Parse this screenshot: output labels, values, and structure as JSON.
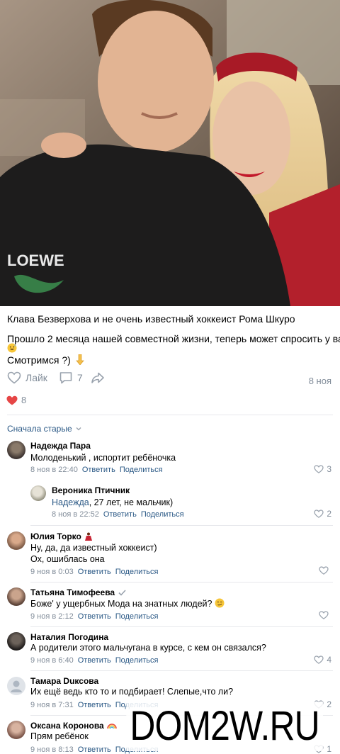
{
  "post": {
    "title": "Клава Безверхова и не очень известный хоккеист Рома Шкуро",
    "line1": "Прошло 2 месяца нашей совместной жизни, теперь может спросить у вас",
    "line2": "Смотримся ?)",
    "like_label": "Лайк",
    "comment_count": "7",
    "date": "8 ноя",
    "reaction_count": "8"
  },
  "comments_header": {
    "sort_label": "Сначала старые"
  },
  "comments": [
    {
      "name": "Надежда Пара",
      "text": "Молоденький , испортит ребёночка",
      "time": "8 ноя в 22:40",
      "reply": "Ответить",
      "share": "Поделиться",
      "likes": "3"
    },
    {
      "name": "Вероника Птичник",
      "reply_to": "Надежда",
      "text": ", 27 лет, не мальчик)",
      "time": "8 ноя в 22:52",
      "reply": "Ответить",
      "share": "Поделиться",
      "likes": "2"
    },
    {
      "name": "Юлия Торко",
      "text": "Ну, да, да известный хоккеист)",
      "text2": "Ох, ошиблась она",
      "time": "9 ноя в 0:03",
      "reply": "Ответить",
      "share": "Поделиться"
    },
    {
      "name": "Татьяна Тимофеева",
      "text": "Боже' у ущербных Мода на знатных людей?",
      "time": "9 ноя в 2:12",
      "reply": "Ответить",
      "share": "Поделиться"
    },
    {
      "name": "Наталия Погодина",
      "text": "А родители этого мальчугана в курсе, с кем он связался?",
      "time": "9 ноя в 6:40",
      "reply": "Ответить",
      "share": "Поделиться",
      "likes": "4"
    },
    {
      "name": "Тамара Duксова",
      "text": "Их ещё ведь кто то и подбирает! Слепые,что ли?",
      "time": "9 ноя в 7:31",
      "reply": "Ответить",
      "share": "Поделиться",
      "likes": "2"
    },
    {
      "name": "Оксана Коронова",
      "text": "Прям ребёнок",
      "time": "9 ноя в 8:13",
      "reply": "Ответить",
      "share": "Поделиться",
      "likes": "1"
    }
  ],
  "watermark": "DOM2W.RU",
  "colors": {
    "link": "#2a5885",
    "muted": "#818c99",
    "heart": "#e64646",
    "divider": "#e7e8ec"
  }
}
